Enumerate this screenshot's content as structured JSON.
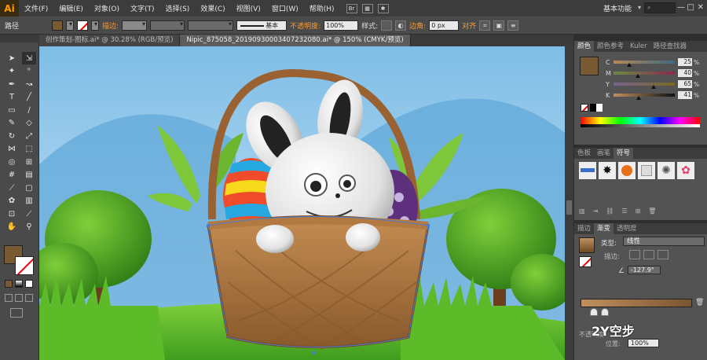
{
  "menubar": {
    "logo": "Ai",
    "items": [
      "文件(F)",
      "编辑(E)",
      "对象(O)",
      "文字(T)",
      "选择(S)",
      "效果(C)",
      "视图(V)",
      "窗口(W)",
      "帮助(H)"
    ],
    "workspace": "基本功能",
    "win_controls": [
      "—",
      "□",
      "✕"
    ]
  },
  "controlbar": {
    "selection_label": "路径",
    "stroke_label": "描边:",
    "stroke_style": "基本",
    "opacity_label": "不透明度:",
    "opacity_value": "100%",
    "style_label": "样式:",
    "corner_label": "边角:",
    "corner_value": "0 px",
    "align_label": "对齐",
    "fill_color": "#7a5a33"
  },
  "tabs": [
    {
      "label": "创作策划-图标.ai* @ 30.28% (RGB/预览)",
      "active": false
    },
    {
      "label": "Nipic_875058_20190930003407232080.ai* @ 150% (CMYK/预览)",
      "active": true
    }
  ],
  "toolbar": {
    "tools": [
      "selection-tool",
      "direct-selection-tool",
      "magic-wand-tool",
      "lasso-tool",
      "pen-tool",
      "curvature-tool",
      "type-tool",
      "line-tool",
      "rectangle-tool",
      "paintbrush-tool",
      "pencil-tool",
      "eraser-tool",
      "rotate-tool",
      "scale-tool",
      "width-tool",
      "free-transform-tool",
      "shape-builder-tool",
      "perspective-tool",
      "mesh-tool",
      "gradient-tool",
      "eyedropper-tool",
      "blend-tool",
      "symbol-sprayer-tool",
      "column-graph-tool",
      "artboard-tool",
      "slice-tool",
      "hand-tool",
      "zoom-tool"
    ],
    "fill_color": "#7a5a33"
  },
  "color_panel": {
    "tabs": [
      "颜色",
      "颜色参考",
      "Kuler",
      "路径查找器"
    ],
    "swatch_color": "#7a5a33",
    "channels": [
      {
        "label": "C",
        "value": "25",
        "pos": 0.25,
        "track": "linear-gradient(to right,#b58a55,#3e6b80)"
      },
      {
        "label": "M",
        "value": "40",
        "pos": 0.4,
        "track": "linear-gradient(to right,#6b8a40,#8a2a50)"
      },
      {
        "label": "Y",
        "value": "65",
        "pos": 0.65,
        "track": "linear-gradient(to right,#7a6090,#7a6a20)"
      },
      {
        "label": "K",
        "value": "41",
        "pos": 0.41,
        "track": "linear-gradient(to right,#c09060,#111)"
      }
    ],
    "percent": "%"
  },
  "swatch_panel": {
    "tabs": [
      "色板",
      "画笔",
      "符号"
    ]
  },
  "gradient_panel": {
    "tabs": [
      "描边",
      "渐变",
      "透明度"
    ],
    "type_label": "类型:",
    "type_value": "线性",
    "stroke_label": "描边:",
    "angle_value": "-127.9°",
    "opacity_label": "不透明度:",
    "opacity_value": "100%",
    "location_label": "位置:",
    "location_value": "100%"
  },
  "watermark": "2Y空步"
}
